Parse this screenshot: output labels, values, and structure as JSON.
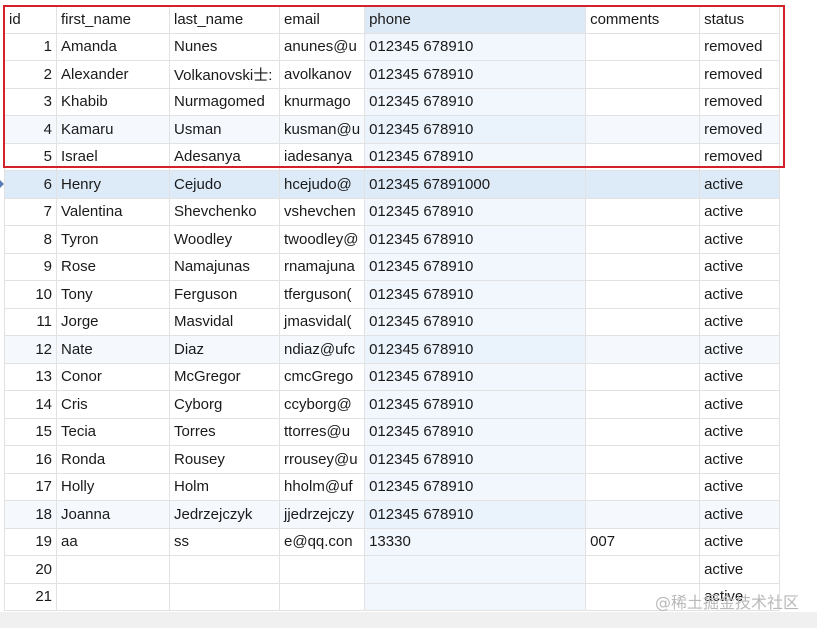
{
  "columns": [
    {
      "key": "id",
      "label": "id"
    },
    {
      "key": "first_name",
      "label": "first_name"
    },
    {
      "key": "last_name",
      "label": "last_name"
    },
    {
      "key": "email",
      "label": "email"
    },
    {
      "key": "phone",
      "label": "phone"
    },
    {
      "key": "comments",
      "label": "comments"
    },
    {
      "key": "status",
      "label": "status"
    }
  ],
  "rows": [
    {
      "id": "1",
      "first_name": "Amanda",
      "last_name": "Nunes",
      "email": "anunes@u",
      "phone": "012345 678910",
      "comments": "",
      "status": "removed"
    },
    {
      "id": "2",
      "first_name": "Alexander",
      "last_name": "Volkanovski士:",
      "email": "avolkanov",
      "phone": "012345 678910",
      "comments": "",
      "status": "removed"
    },
    {
      "id": "3",
      "first_name": "Khabib",
      "last_name": "Nurmagomed",
      "email": "knurmago",
      "phone": "012345 678910",
      "comments": "",
      "status": "removed"
    },
    {
      "id": "4",
      "first_name": "Kamaru",
      "last_name": "Usman",
      "email": "kusman@u",
      "phone": "012345 678910",
      "comments": "",
      "status": "removed"
    },
    {
      "id": "5",
      "first_name": "Israel",
      "last_name": "Adesanya",
      "email": "iadesanya",
      "phone": "012345 678910",
      "comments": "",
      "status": "removed"
    },
    {
      "id": "6",
      "first_name": "Henry",
      "last_name": "Cejudo",
      "email": "hcejudo@",
      "phone": "012345 67891000",
      "comments": "",
      "status": "active"
    },
    {
      "id": "7",
      "first_name": "Valentina",
      "last_name": "Shevchenko",
      "email": "vshevchen",
      "phone": "012345 678910",
      "comments": "",
      "status": "active"
    },
    {
      "id": "8",
      "first_name": "Tyron",
      "last_name": "Woodley",
      "email": "twoodley@",
      "phone": "012345 678910",
      "comments": "",
      "status": "active"
    },
    {
      "id": "9",
      "first_name": "Rose",
      "last_name": "Namajunas",
      "email": "rnamajuna",
      "phone": "012345 678910",
      "comments": "",
      "status": "active"
    },
    {
      "id": "10",
      "first_name": "Tony",
      "last_name": "Ferguson",
      "email": "tferguson(",
      "phone": "012345 678910",
      "comments": "",
      "status": "active"
    },
    {
      "id": "11",
      "first_name": "Jorge",
      "last_name": "Masvidal",
      "email": "jmasvidal(",
      "phone": "012345 678910",
      "comments": "",
      "status": "active"
    },
    {
      "id": "12",
      "first_name": "Nate",
      "last_name": "Diaz",
      "email": "ndiaz@ufc",
      "phone": "012345 678910",
      "comments": "",
      "status": "active"
    },
    {
      "id": "13",
      "first_name": "Conor",
      "last_name": "McGregor",
      "email": "cmcGrego",
      "phone": "012345 678910",
      "comments": "",
      "status": "active"
    },
    {
      "id": "14",
      "first_name": "Cris",
      "last_name": "Cyborg",
      "email": "ccyborg@",
      "phone": "012345 678910",
      "comments": "",
      "status": "active"
    },
    {
      "id": "15",
      "first_name": "Tecia",
      "last_name": "Torres",
      "email": "ttorres@u",
      "phone": "012345 678910",
      "comments": "",
      "status": "active"
    },
    {
      "id": "16",
      "first_name": "Ronda",
      "last_name": "Rousey",
      "email": "rrousey@u",
      "phone": "012345 678910",
      "comments": "",
      "status": "active"
    },
    {
      "id": "17",
      "first_name": "Holly",
      "last_name": "Holm",
      "email": "hholm@uf",
      "phone": "012345 678910",
      "comments": "",
      "status": "active"
    },
    {
      "id": "18",
      "first_name": "Joanna",
      "last_name": "Jedrzejczyk",
      "email": "jjedrzejczy",
      "phone": "012345 678910",
      "comments": "",
      "status": "active"
    },
    {
      "id": "19",
      "first_name": "aa",
      "last_name": "ss",
      "email": "e@qq.con",
      "phone": "13330",
      "comments": "007",
      "status": "active"
    },
    {
      "id": "20",
      "first_name": "",
      "last_name": "",
      "email": "",
      "phone": "",
      "comments": "",
      "status": "active"
    },
    {
      "id": "21",
      "first_name": "",
      "last_name": "",
      "email": "",
      "phone": "",
      "comments": "",
      "status": "active"
    }
  ],
  "selected_row_id": "6",
  "alternating_row_ids": [
    "4",
    "12",
    "18"
  ],
  "highlighted_row_ids": [
    "1",
    "2",
    "3",
    "4",
    "5"
  ],
  "highlight_color": "#d4222a",
  "sorted_column": "phone",
  "watermark": "@稀土掘金技术社区"
}
